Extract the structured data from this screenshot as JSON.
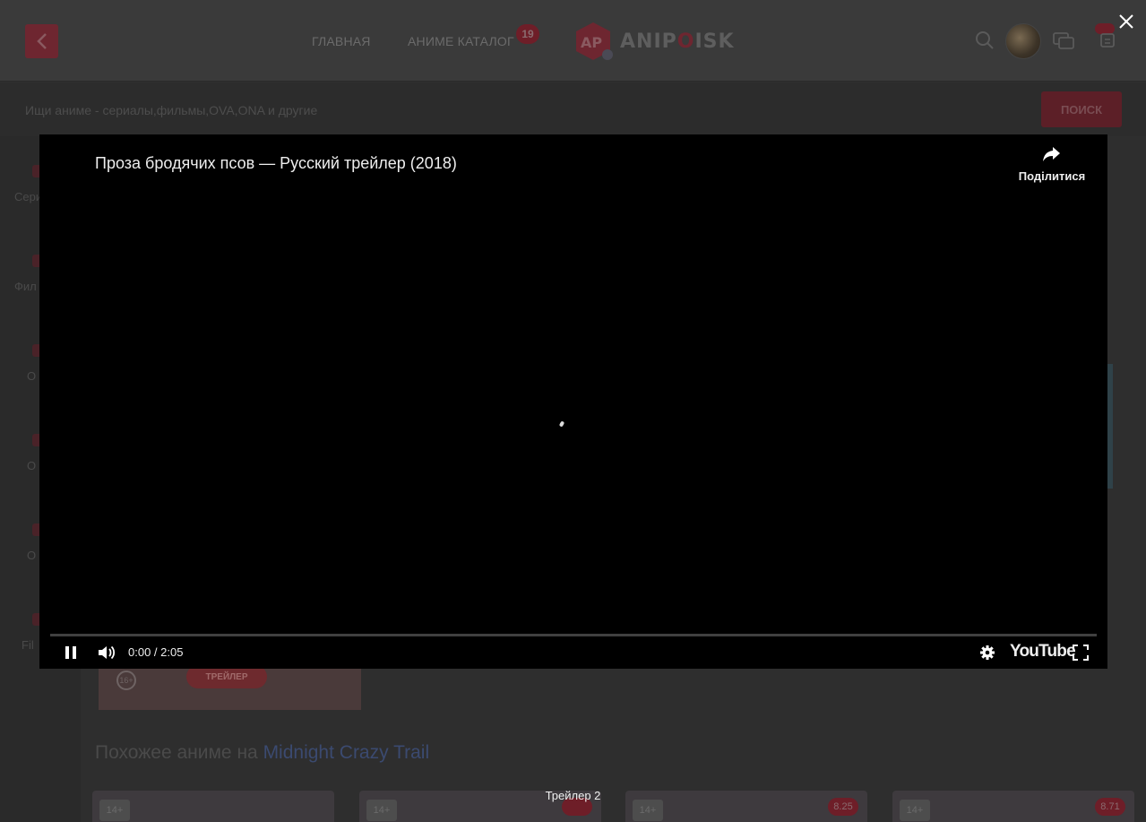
{
  "header": {
    "nav_home": "ГЛАВНАЯ",
    "nav_catalog": "АНИМЕ КАТАЛОГ",
    "catalog_badge": "19",
    "logo_text_pre": "ANIP",
    "logo_text_o": "O",
    "logo_text_post": "ISK"
  },
  "search": {
    "placeholder": "Ищи аниме - сериалы,фильмы,OVA,ONA и другие",
    "button_label": "ПОИСК"
  },
  "sidebar": {
    "items": [
      {
        "label": "Сери"
      },
      {
        "label": "Фил"
      },
      {
        "label": "О"
      },
      {
        "label": "О"
      },
      {
        "label": "О"
      },
      {
        "label": "Fil"
      }
    ]
  },
  "poster": {
    "age": "16+",
    "button_label": "ТРЕЙЛЕР"
  },
  "similar": {
    "title_prefix": "Похожее аниме на ",
    "title_highlight": "Midnight Crazy Trail",
    "thumbs": [
      {
        "age": "14+",
        "score": ""
      },
      {
        "age": "14+",
        "score": ""
      },
      {
        "age": "14+",
        "score": "8.25"
      },
      {
        "age": "14+",
        "score": "8.71"
      }
    ]
  },
  "player": {
    "title": "Проза бродячих псов — Русский трейлер (2018)",
    "share_label": "Поділитися",
    "time": "0:00 / 2:05",
    "progress_fraction": 0.0,
    "youtube_label": "YouTube"
  },
  "caption": "Трейлер 2",
  "icons": {
    "close": "close-icon",
    "back": "chevron-left-icon",
    "search": "search-icon",
    "chat": "chat-icon",
    "notifications": "bell-icon",
    "share": "share-arrow-icon",
    "pause": "pause-icon",
    "volume": "volume-icon",
    "settings": "gear-icon",
    "fullscreen": "fullscreen-icon"
  },
  "colors": {
    "accent": "#c62b3b",
    "overlay": "#000000"
  }
}
